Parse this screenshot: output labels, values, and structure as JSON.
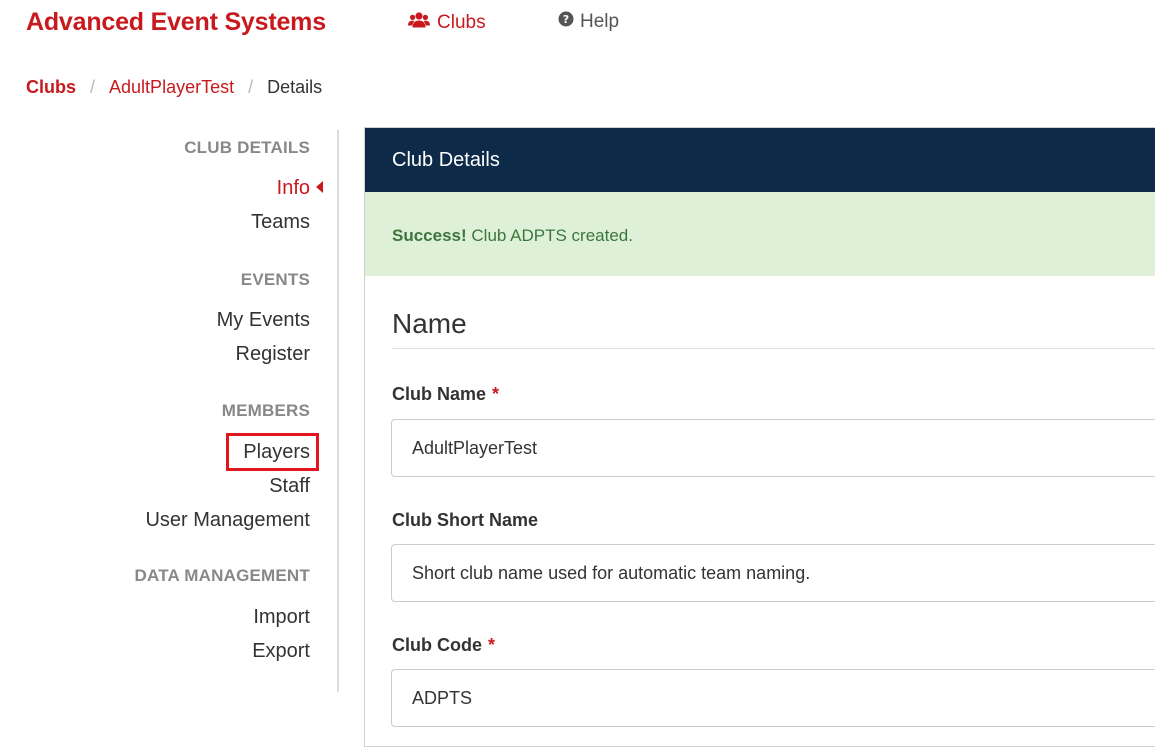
{
  "header": {
    "brand": "Advanced Event Systems",
    "nav": {
      "clubs_label": "Clubs",
      "help_label": "Help"
    }
  },
  "breadcrumb": {
    "root": "Clubs",
    "club": "AdultPlayerTest",
    "current": "Details",
    "separator": "/"
  },
  "sidebar": {
    "sections": [
      {
        "heading": "CLUB DETAILS",
        "items": [
          "Info",
          "Teams"
        ]
      },
      {
        "heading": "EVENTS",
        "items": [
          "My Events",
          "Register"
        ]
      },
      {
        "heading": "MEMBERS",
        "items": [
          "Players",
          "Staff",
          "User Management"
        ]
      },
      {
        "heading": "DATA MANAGEMENT",
        "items": [
          "Import",
          "Export"
        ]
      }
    ],
    "active_item": "Info",
    "highlighted_item": "Players"
  },
  "panel": {
    "title": "Club Details",
    "alert": {
      "strong": "Success!",
      "message": " Club ADPTS created."
    },
    "section_title": "Name",
    "fields": {
      "club_name": {
        "label": "Club Name",
        "required": "*",
        "value": "AdultPlayerTest"
      },
      "club_short_name": {
        "label": "Club Short Name",
        "placeholder": "Short club name used for automatic team naming."
      },
      "club_code": {
        "label": "Club Code",
        "required": "*",
        "value": "ADPTS"
      }
    }
  },
  "colors": {
    "brand_red": "#c8191f",
    "header_navy": "#0d2a48",
    "success_bg": "#dff0d8",
    "success_text": "#3c763d",
    "highlight": "#e2141c"
  },
  "icons": {
    "clubs": "users-icon",
    "help": "question-circle-icon"
  }
}
